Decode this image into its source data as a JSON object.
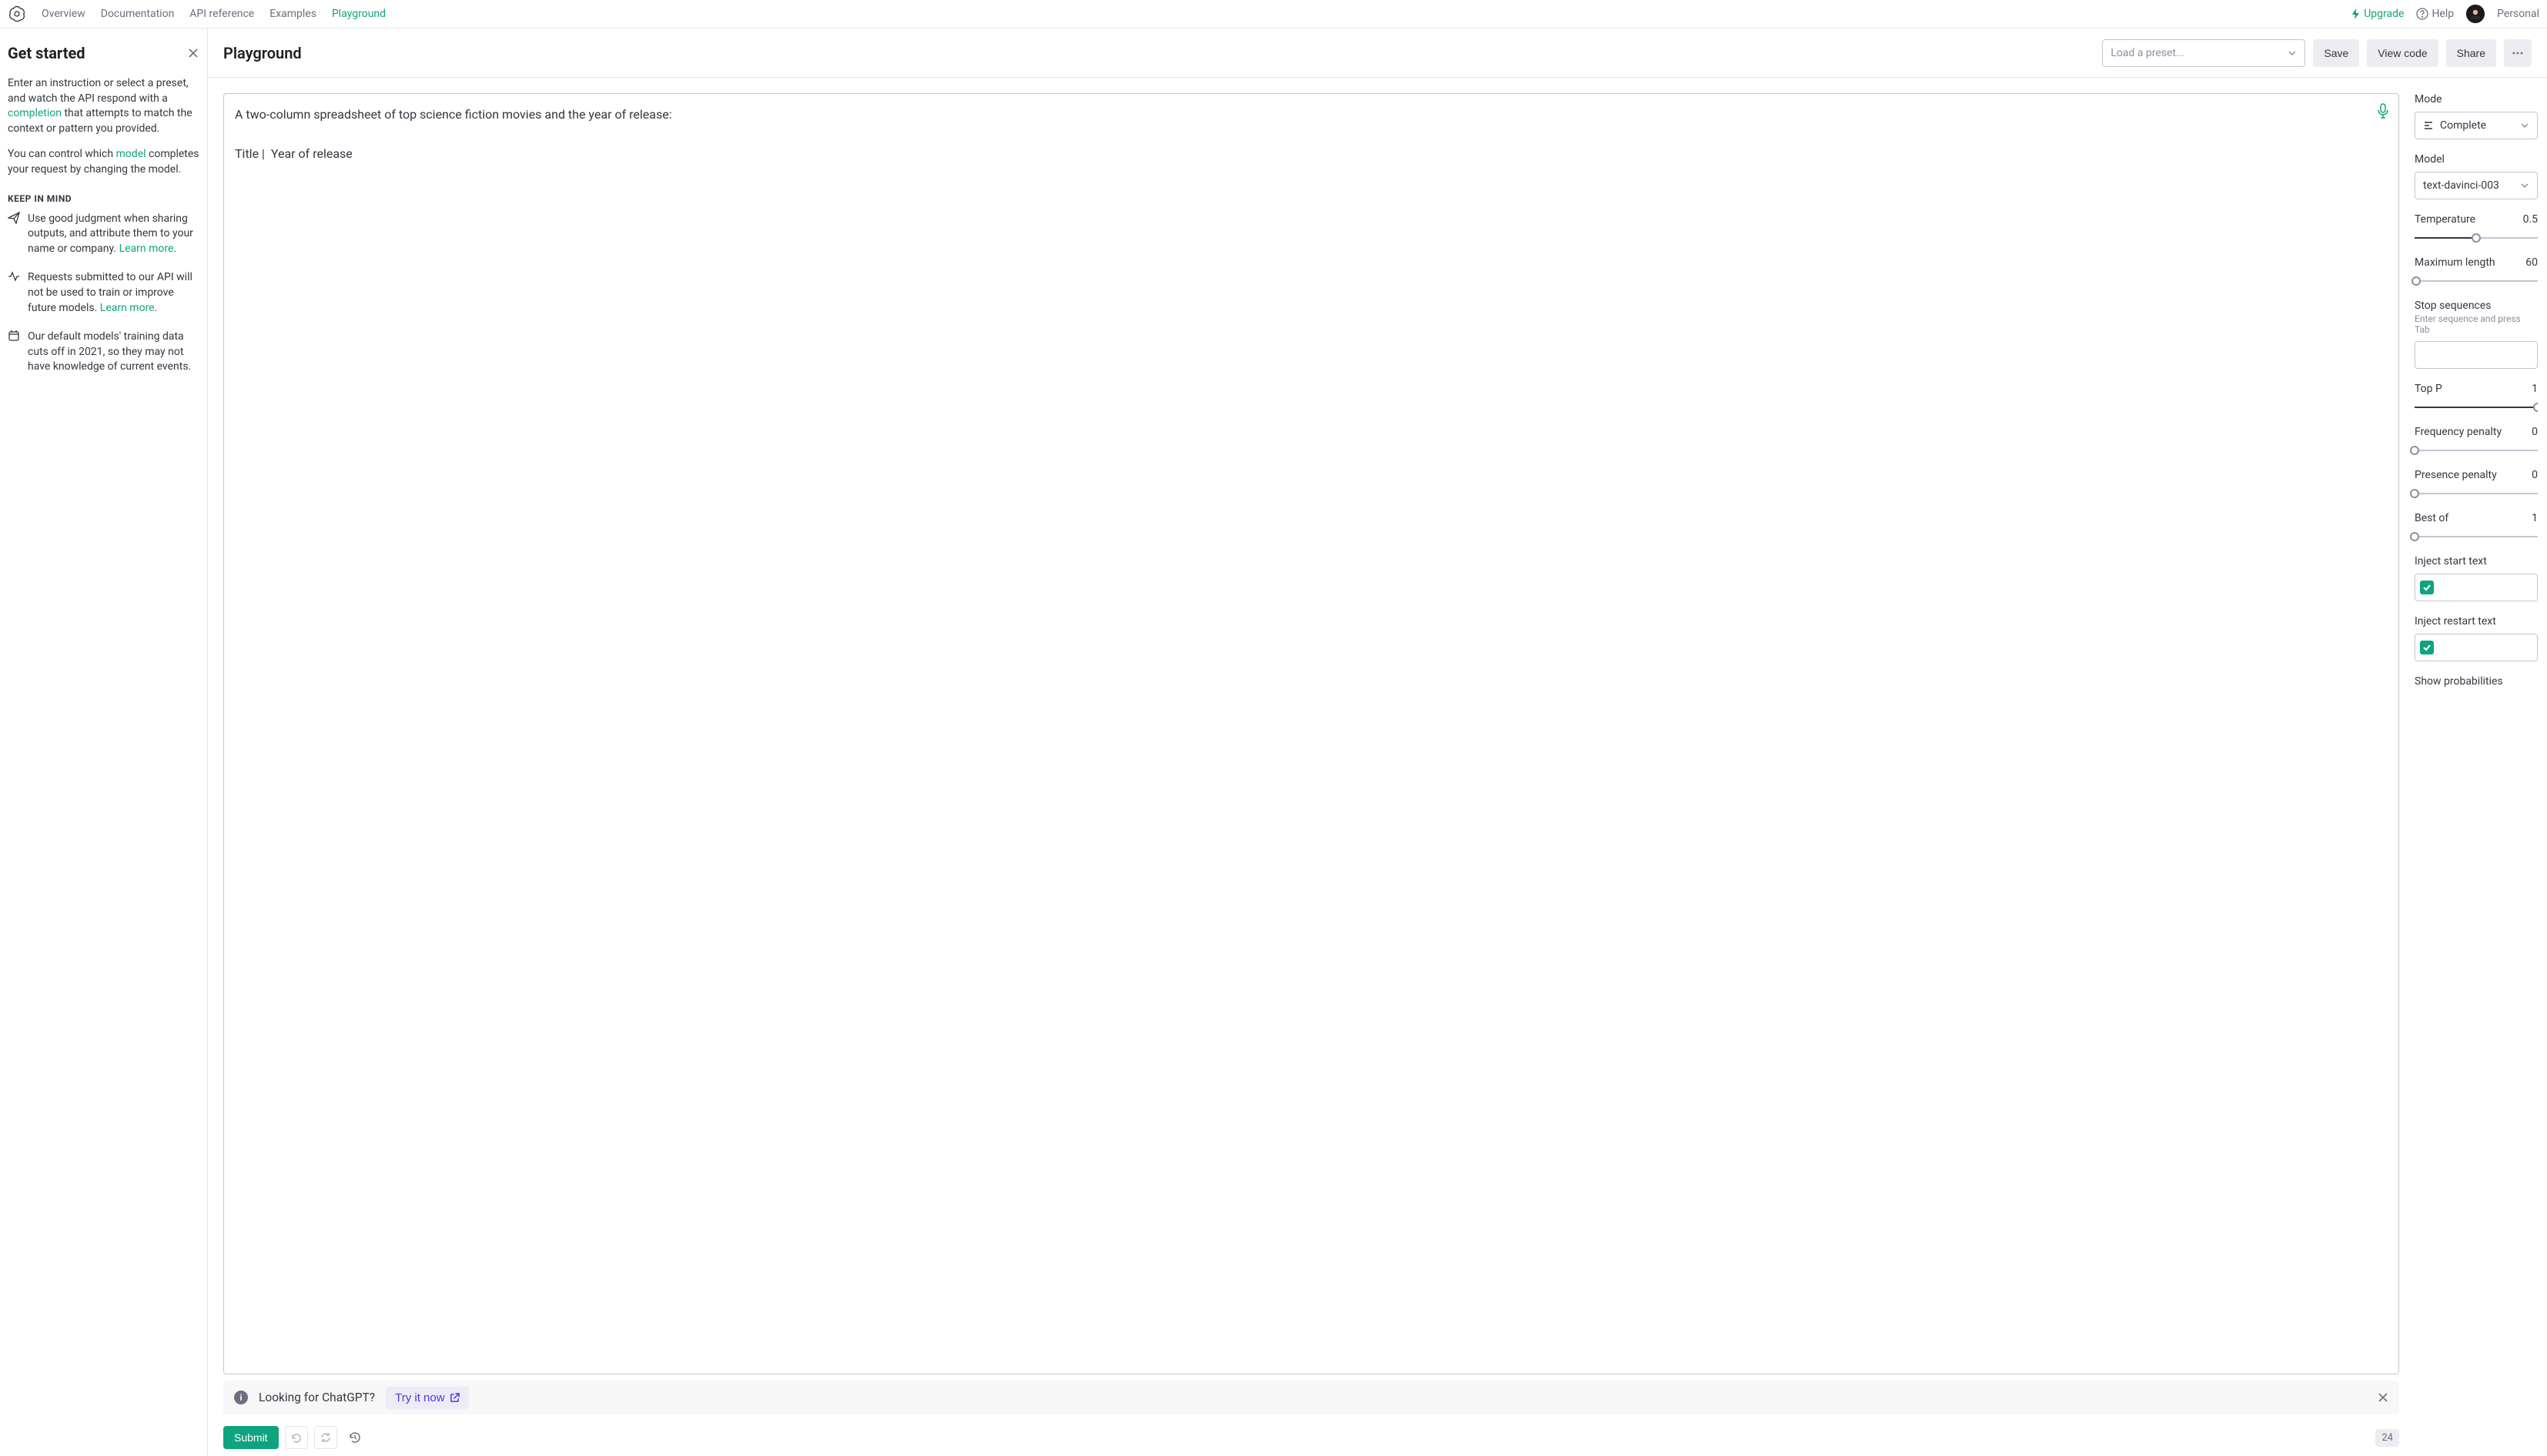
{
  "nav": {
    "items": [
      "Overview",
      "Documentation",
      "API reference",
      "Examples",
      "Playground"
    ],
    "active_index": 4,
    "upgrade": "Upgrade",
    "help": "Help",
    "profile": "Personal"
  },
  "sidebar": {
    "title": "Get started",
    "intro_part1": "Enter an instruction or select a preset, and watch the API respond with a ",
    "intro_link1": "completion",
    "intro_part2": " that attempts to match the context or pattern you provided.",
    "para2_part1": "You can control which ",
    "para2_link": "model",
    "para2_part2": " completes your request by changing the model.",
    "keep_heading": "KEEP IN MIND",
    "tips": [
      {
        "text_a": "Use good judgment when sharing outputs, and attribute them to your name or company. ",
        "link": "Learn more",
        "text_b": "."
      },
      {
        "text_a": "Requests submitted to our API will not be used to train or improve future models. ",
        "link": "Learn more",
        "text_b": "."
      },
      {
        "text_a": "Our default models' training data cuts off in 2021, so they may not have knowledge of current events.",
        "link": "",
        "text_b": ""
      }
    ]
  },
  "header": {
    "title": "Playground",
    "preset_placeholder": "Load a preset...",
    "save": "Save",
    "view_code": "View code",
    "share": "Share"
  },
  "editor": {
    "content": "A two-column spreadsheet of top science fiction movies and the year of release:\n\nTitle |  Year of release"
  },
  "banner": {
    "text": "Looking for ChatGPT?",
    "try_label": "Try it now"
  },
  "bottom": {
    "submit": "Submit",
    "token_count": "24"
  },
  "settings": {
    "mode": {
      "label": "Mode",
      "value": "Complete"
    },
    "model": {
      "label": "Model",
      "value": "text-davinci-003"
    },
    "temperature": {
      "label": "Temperature",
      "value": "0.5",
      "pct": 50
    },
    "max_length": {
      "label": "Maximum length",
      "value": "60",
      "pct": 1.5
    },
    "stop": {
      "label": "Stop sequences",
      "hint": "Enter sequence and press Tab"
    },
    "top_p": {
      "label": "Top P",
      "value": "1",
      "pct": 100
    },
    "freq_penalty": {
      "label": "Frequency penalty",
      "value": "0",
      "pct": 0
    },
    "pres_penalty": {
      "label": "Presence penalty",
      "value": "0",
      "pct": 0
    },
    "best_of": {
      "label": "Best of",
      "value": "1",
      "pct": 0
    },
    "inject_start": {
      "label": "Inject start text"
    },
    "inject_restart": {
      "label": "Inject restart text"
    },
    "show_probs": {
      "label": "Show probabilities"
    }
  }
}
